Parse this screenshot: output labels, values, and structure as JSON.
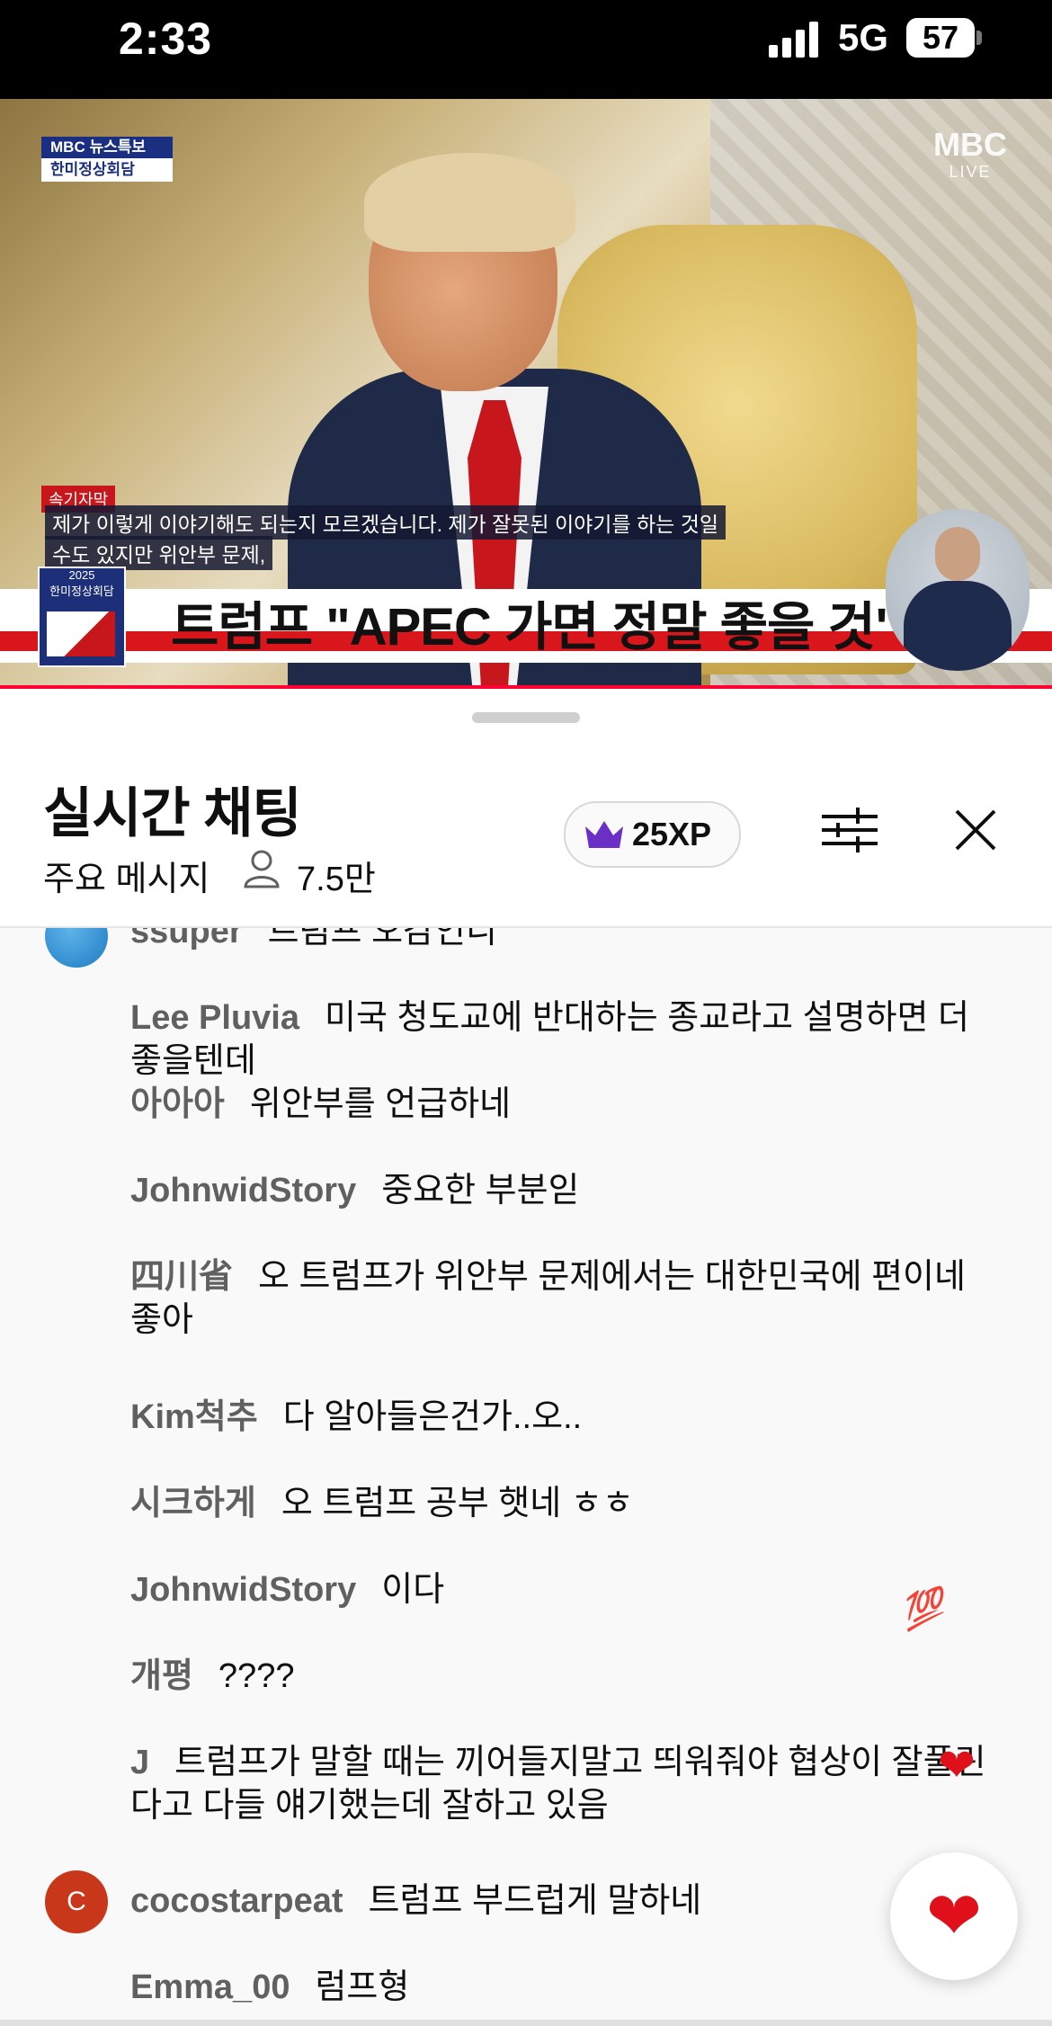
{
  "status_bar": {
    "time": "2:33",
    "network": "5G",
    "battery": "57"
  },
  "video": {
    "channel_badge_top": "MBC 뉴스특보",
    "channel_badge_bottom": "한미정상회담",
    "logo": "MBC",
    "logo_sub": "LIVE",
    "subtitle_tag": "속기자막",
    "subtitle_line1": "제가 이렇게 이야기해도 되는지 모르겠습니다. 제가 잘못된 이야기를 하는 것일",
    "subtitle_line2": "수도 있지만 위안부 문제,",
    "headline": "트럼프 \"APEC 가면 정말 좋을 것\"",
    "event_logo_year": "2025",
    "event_logo_name": "한미정상회담",
    "progress_fraction": 1.0
  },
  "chat": {
    "title": "실시간 채팅",
    "mode": "주요 메시지",
    "viewers": "7.5만",
    "xp": "25XP",
    "messages": [
      {
        "author": "ssuper",
        "text": "트럼프 오감인니",
        "avatar": "blue-circle"
      },
      {
        "author": "Lee Pluvia",
        "text": "미국 청도교에 반대하는 종교라고 설명하면 더 좋을텐데"
      },
      {
        "author": "아아아",
        "text": "위안부를 언급하네"
      },
      {
        "author": "JohnwidStory",
        "text": "중요한 부분읻"
      },
      {
        "author": "四川省",
        "text": "오 트럼프가 위안부 문제에서는 대한민국에 편이네 좋아"
      },
      {
        "author": "Kim척추",
        "text": "다 알아들은건가..오.."
      },
      {
        "author": "시크하게",
        "text": "오 트럼프 공부 햇네 ㅎㅎ"
      },
      {
        "author": "JohnwidStory",
        "text": "이다"
      },
      {
        "author": "개평",
        "text": "????"
      },
      {
        "author": "J",
        "text": "트럼프가 말할 때는 끼어들지말고 띄워줘야 협상이 잘풀린다고 다들 얘기했는데 잘하고 있음"
      },
      {
        "author": "cocostarpeat",
        "text": "트럼프 부드럽게 말하네",
        "avatar_letter": "C"
      },
      {
        "author": "Emma_00",
        "text": "럼프형"
      }
    ],
    "float_emoji_100": "💯",
    "float_emoji_heart": "❤",
    "like_button_icon": "heart-icon"
  },
  "colors": {
    "accent_red": "#ff0033",
    "text_primary": "#0f0f0f",
    "author_gray": "#606060"
  }
}
